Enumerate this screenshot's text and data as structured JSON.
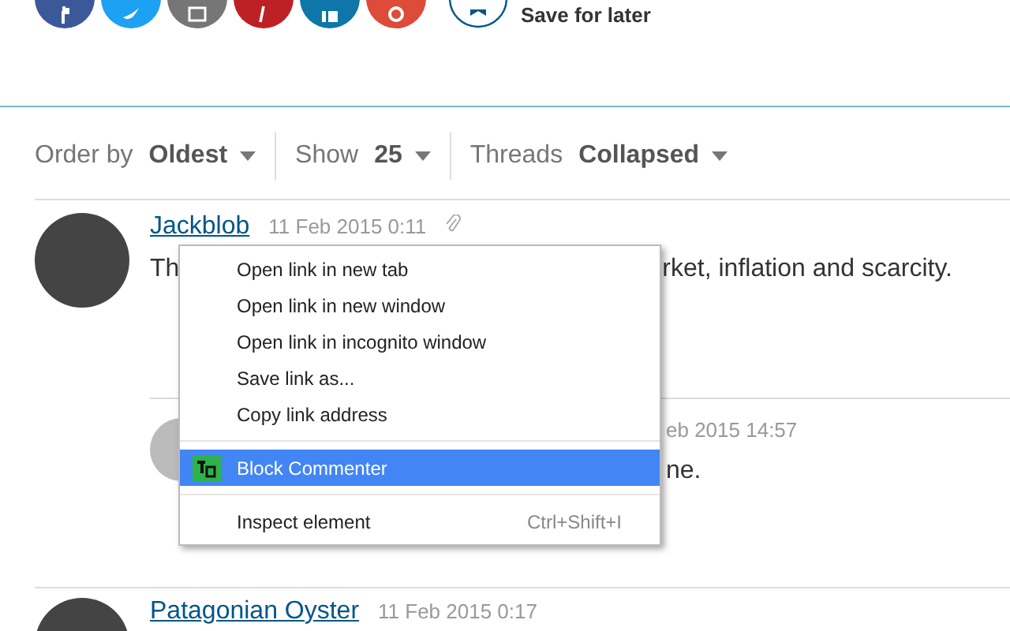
{
  "share": {
    "buttons": [
      {
        "kind": "facebook",
        "color": "#3b5998"
      },
      {
        "kind": "twitter",
        "color": "#1da1f2"
      },
      {
        "kind": "email",
        "color": "#767676"
      },
      {
        "kind": "pinterest",
        "color": "#bd2126"
      },
      {
        "kind": "linkedin",
        "color": "#0e76a8"
      },
      {
        "kind": "google",
        "color": "#dd4b39"
      }
    ],
    "save_label": "Save for later"
  },
  "filters": [
    {
      "label": "Order by",
      "value": "Oldest"
    },
    {
      "label": "Show",
      "value": "25"
    },
    {
      "label": "Threads",
      "value": "Collapsed"
    }
  ],
  "comments": [
    {
      "kind": "top",
      "author": "Jackblob",
      "date": "11 Feb 2015 0:11",
      "text_start": "Th",
      "text_end": "rket, inflation and scarcity."
    },
    {
      "kind": "reply",
      "date": "eb 2015 14:57",
      "text_end": "ne."
    },
    {
      "kind": "top",
      "author": "Patagonian Oyster",
      "date": "11 Feb 2015 0:17"
    }
  ],
  "context_menu": [
    {
      "kind": "item",
      "label": "Open link in new tab",
      "selected": false
    },
    {
      "kind": "item",
      "label": "Open link in new window",
      "selected": false
    },
    {
      "kind": "item",
      "label": "Open link in incognito window",
      "selected": false
    },
    {
      "kind": "item",
      "label": "Save link as...",
      "selected": false
    },
    {
      "kind": "item",
      "label": "Copy link address",
      "selected": false
    },
    {
      "kind": "separator"
    },
    {
      "kind": "extension",
      "label": "Block Commenter",
      "selected": true
    },
    {
      "kind": "separator"
    },
    {
      "kind": "item",
      "label": "Inspect element",
      "shortcut": "Ctrl+Shift+I",
      "selected": false
    }
  ]
}
